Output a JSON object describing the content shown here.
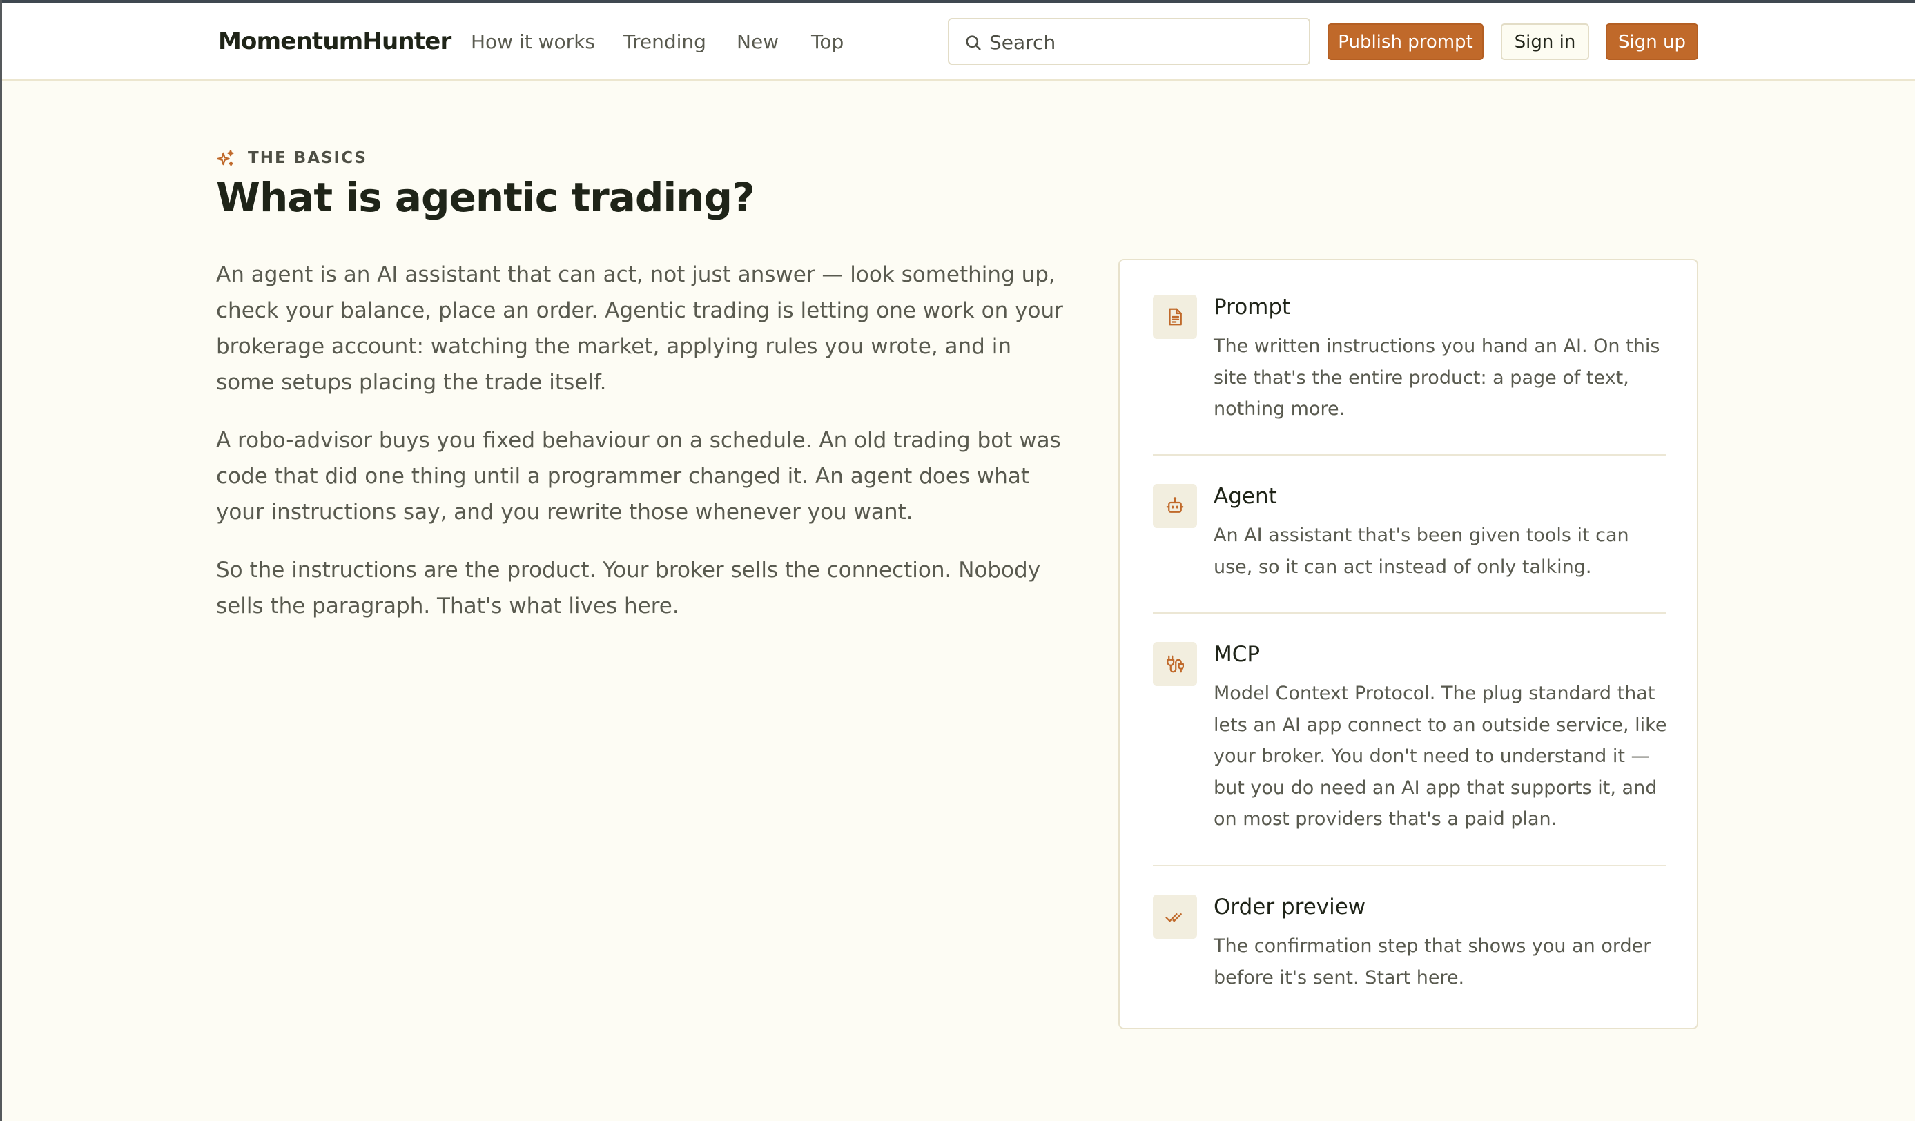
{
  "brand": "MomentumHunter",
  "nav": {
    "items": [
      "How it works",
      "Trending",
      "New",
      "Top"
    ]
  },
  "search": {
    "placeholder": "Search",
    "icon": "search-icon"
  },
  "actions": {
    "publish": "Publish prompt",
    "sign_in": "Sign in",
    "sign_up": "Sign up"
  },
  "colors": {
    "accent": "#c0692a",
    "background": "#fdfcf4",
    "heading": "#1f2418",
    "text": "#595a4f",
    "border": "#e8e2cc"
  },
  "section": {
    "eyebrow_icon": "sparkles-icon",
    "eyebrow": "THE BASICS",
    "title": "What is agentic trading?",
    "paragraphs": [
      "An agent is an AI assistant that can act, not just answer — look something up, check your balance, place an order. Agentic trading is letting one work on your brokerage account: watching the market, applying rules you wrote, and in some setups placing the trade itself.",
      "A robo-advisor buys you fixed behaviour on a schedule. An old trading bot was code that did one thing until a programmer changed it. An agent does what your instructions say, and you rewrite those whenever you want.",
      "So the instructions are the product. Your broker sells the connection. Nobody sells the paragraph. That's what lives here."
    ]
  },
  "glossary": [
    {
      "icon": "document-icon",
      "term": "Prompt",
      "definition": "The written instructions you hand an AI. On this site that's the entire product: a page of text, nothing more."
    },
    {
      "icon": "robot-icon",
      "term": "Agent",
      "definition": "An AI assistant that's been given tools it can use, so it can act instead of only talking."
    },
    {
      "icon": "plug-icon",
      "term": "MCP",
      "definition": "Model Context Protocol. The plug standard that lets an AI app connect to an outside service, like your broker. You don't need to understand it — but you do need an AI app that supports it, and on most providers that's a paid plan."
    },
    {
      "icon": "double-check-icon",
      "term": "Order preview",
      "definition": "The confirmation step that shows you an order before it's sent. Start here."
    }
  ]
}
